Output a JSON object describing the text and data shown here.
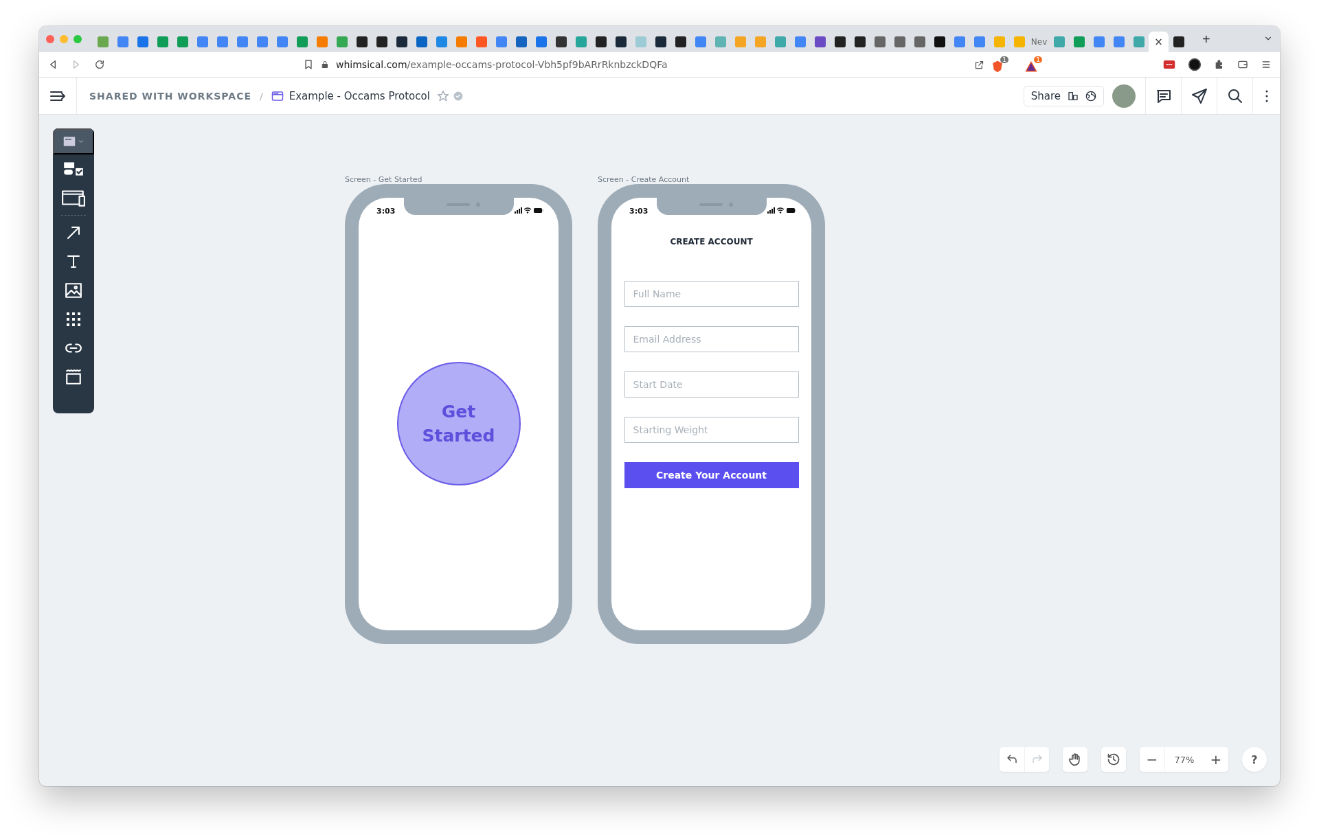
{
  "browser": {
    "tabs": [
      {
        "selected": false
      },
      {
        "selected": false
      },
      {
        "selected": false
      },
      {
        "selected": false
      },
      {
        "selected": false
      },
      {
        "selected": false
      },
      {
        "selected": false
      },
      {
        "selected": false
      },
      {
        "selected": false
      },
      {
        "selected": false
      },
      {
        "selected": false
      },
      {
        "selected": false
      },
      {
        "selected": false
      },
      {
        "selected": false
      },
      {
        "selected": false
      },
      {
        "selected": false
      },
      {
        "selected": false
      },
      {
        "selected": false
      },
      {
        "selected": false
      },
      {
        "selected": false
      },
      {
        "selected": false
      },
      {
        "selected": false
      },
      {
        "selected": false
      },
      {
        "selected": false
      },
      {
        "selected": false
      },
      {
        "selected": false
      },
      {
        "selected": false
      },
      {
        "selected": false
      },
      {
        "selected": false
      },
      {
        "selected": false
      },
      {
        "selected": false
      },
      {
        "selected": false
      },
      {
        "selected": false
      },
      {
        "selected": false
      },
      {
        "selected": false
      },
      {
        "selected": false
      },
      {
        "selected": false
      },
      {
        "selected": false
      },
      {
        "selected": false
      },
      {
        "selected": false
      },
      {
        "selected": false
      },
      {
        "selected": false
      },
      {
        "selected": false
      },
      {
        "selected": false
      },
      {
        "selected": false
      },
      {
        "selected": false
      },
      {
        "selected": false
      },
      {
        "selected": false,
        "title": "Nev"
      },
      {
        "selected": false
      },
      {
        "selected": false
      },
      {
        "selected": false
      },
      {
        "selected": false
      },
      {
        "selected": false
      },
      {
        "selected": true,
        "close": "×"
      },
      {
        "selected": false
      }
    ],
    "new_tab": "+",
    "url_host": "whimsical.com",
    "url_path": "/example-occams-protocol-Vbh5pf9bARrRknbzckDQFa",
    "extension_badges": [
      "1",
      "1"
    ]
  },
  "header": {
    "breadcrumb": "SHARED WITH WORKSPACE",
    "separator": "/",
    "title": "Example - Occams Protocol",
    "share": "Share"
  },
  "screens": [
    {
      "kind": "start",
      "label": "Screen - Get Started",
      "time": "3:03",
      "button": "Get Started"
    },
    {
      "kind": "form",
      "label": "Screen - Create Account",
      "time": "3:03",
      "title": "CREATE ACCOUNT",
      "fields": [
        {
          "placeholder": "Full Name"
        },
        {
          "placeholder": "Email Address"
        },
        {
          "placeholder": "Start Date"
        },
        {
          "placeholder": "Starting Weight"
        }
      ],
      "button": "Create Your Account"
    }
  ],
  "controls": {
    "redo_disabled": true,
    "zoom_out": "−",
    "zoom": "77%",
    "zoom_in": "+",
    "help": "?"
  }
}
